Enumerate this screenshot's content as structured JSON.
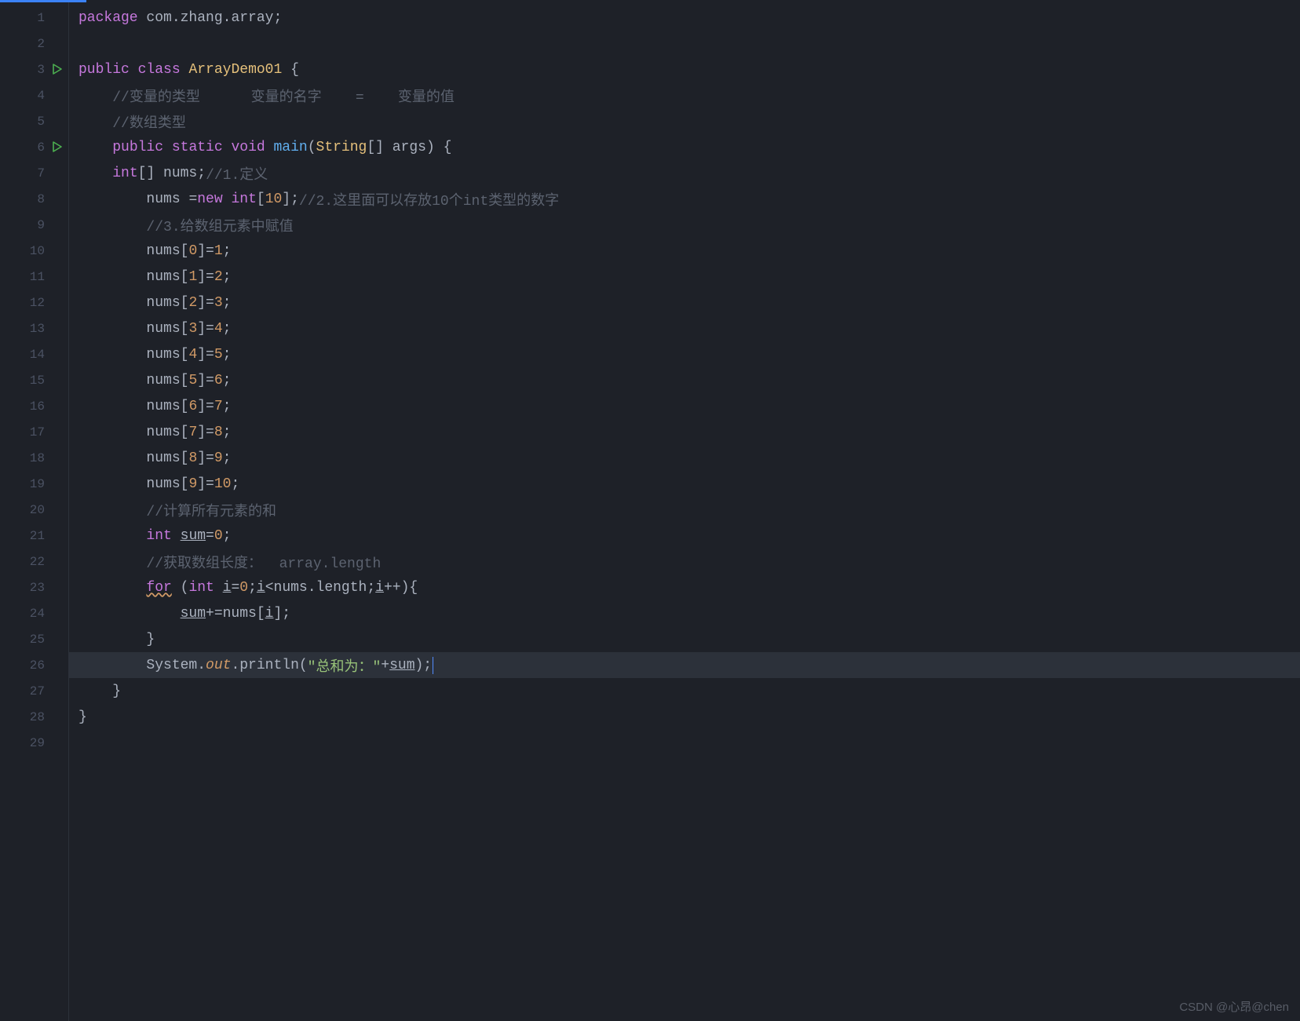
{
  "watermark": "CSDN @心昂@chen",
  "gutter": {
    "lines": [
      1,
      2,
      3,
      4,
      5,
      6,
      7,
      8,
      9,
      10,
      11,
      12,
      13,
      14,
      15,
      16,
      17,
      18,
      19,
      20,
      21,
      22,
      23,
      24,
      25,
      26,
      27,
      28,
      29
    ],
    "run_icons_on": [
      3,
      6
    ]
  },
  "code": {
    "l1": {
      "kw1": "package",
      "pkg": " com.zhang.array",
      "sc": ";"
    },
    "l3": {
      "kw1": "public",
      "kw2": "class",
      "cls": "ArrayDemo01",
      "br": "{"
    },
    "l4": {
      "com": "//变量的类型      变量的名字    =    变量的值"
    },
    "l5": {
      "com": "//数组类型"
    },
    "l6": {
      "kw1": "public",
      "kw2": "static",
      "kw3": "void",
      "fn": "main",
      "lp": "(",
      "ty": "String",
      "arr": "[] ",
      "arg": "args",
      "rp": ") {"
    },
    "l7": {
      "kw": "int",
      "arr": "[] ",
      "var": "nums",
      "sc": ";",
      "com": "//1.定义"
    },
    "l8": {
      "var": "nums ",
      "eq": "=",
      "kw": "new ",
      "ty": "int",
      "lb": "[",
      "n": "10",
      "rb": "];",
      "com": "//2.这里面可以存放10个int类型的数字"
    },
    "l9": {
      "com": "//3.给数组元素中赋值"
    },
    "l10": {
      "var": "nums[",
      "idx": "0",
      "mid": "]=",
      "val": "1",
      "sc": ";"
    },
    "l11": {
      "var": "nums[",
      "idx": "1",
      "mid": "]=",
      "val": "2",
      "sc": ";"
    },
    "l12": {
      "var": "nums[",
      "idx": "2",
      "mid": "]=",
      "val": "3",
      "sc": ";"
    },
    "l13": {
      "var": "nums[",
      "idx": "3",
      "mid": "]=",
      "val": "4",
      "sc": ";"
    },
    "l14": {
      "var": "nums[",
      "idx": "4",
      "mid": "]=",
      "val": "5",
      "sc": ";"
    },
    "l15": {
      "var": "nums[",
      "idx": "5",
      "mid": "]=",
      "val": "6",
      "sc": ";"
    },
    "l16": {
      "var": "nums[",
      "idx": "6",
      "mid": "]=",
      "val": "7",
      "sc": ";"
    },
    "l17": {
      "var": "nums[",
      "idx": "7",
      "mid": "]=",
      "val": "8",
      "sc": ";"
    },
    "l18": {
      "var": "nums[",
      "idx": "8",
      "mid": "]=",
      "val": "9",
      "sc": ";"
    },
    "l19": {
      "var": "nums[",
      "idx": "9",
      "mid": "]=",
      "val": "10",
      "sc": ";"
    },
    "l20": {
      "com": "//计算所有元素的和"
    },
    "l21": {
      "kw": "int ",
      "var": "sum",
      "eq": "=",
      "val": "0",
      "sc": ";"
    },
    "l22": {
      "com": "//获取数组长度：  array.length"
    },
    "l23": {
      "kw": "for",
      "lp": " (",
      "ty": "int ",
      "i": "i",
      "eq": "=",
      "z": "0",
      "sc1": ";",
      "i2": "i",
      "lt": "<nums.length;",
      "i3": "i",
      "pp": "++){"
    },
    "l24": {
      "sum": "sum",
      "pe": "+=nums[",
      "i": "i",
      "rb": "];"
    },
    "l25": {
      "br": "}"
    },
    "l26": {
      "sys": "System.",
      "out": "out",
      "pr": ".println(",
      "str": "\"总和为：\"",
      "plus": "+",
      "sum": "sum",
      "end": ");"
    },
    "l27": {
      "br": "}"
    },
    "l28": {
      "br": "}"
    }
  }
}
